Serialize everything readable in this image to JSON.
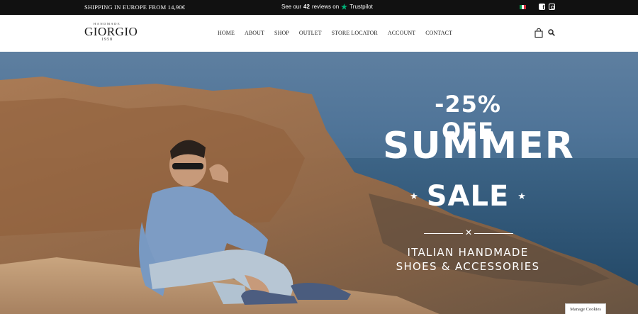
{
  "topbar": {
    "shipping": "SHIPPING IN EUROPE FROM 14,90€",
    "reviews_prefix": "See our",
    "reviews_count": "42",
    "reviews_suffix": "reviews on",
    "trustpilot": "Trustpilot",
    "trustpilot_color": "#00b67a",
    "language_flag": "italian-flag-icon",
    "social": [
      "facebook-icon",
      "instagram-icon"
    ]
  },
  "header": {
    "logo": {
      "top": "HANDMADE",
      "word": "GIORGIO",
      "year": "1958"
    },
    "nav": [
      {
        "label": "HOME"
      },
      {
        "label": "ABOUT"
      },
      {
        "label": "SHOP"
      },
      {
        "label": "OUTLET"
      },
      {
        "label": "STORE LOCATOR"
      },
      {
        "label": "ACCOUNT"
      },
      {
        "label": "CONTACT"
      }
    ],
    "icons": [
      "shopping-bag-icon",
      "search-icon"
    ]
  },
  "hero": {
    "offer": "-25% OFF",
    "headline": "SUMMER",
    "sale": "SALE",
    "tagline_1": "ITALIAN HANDMADE",
    "tagline_2": "SHOES & ACCESSORIES"
  },
  "cookies": {
    "label": "Manage Cookies"
  }
}
